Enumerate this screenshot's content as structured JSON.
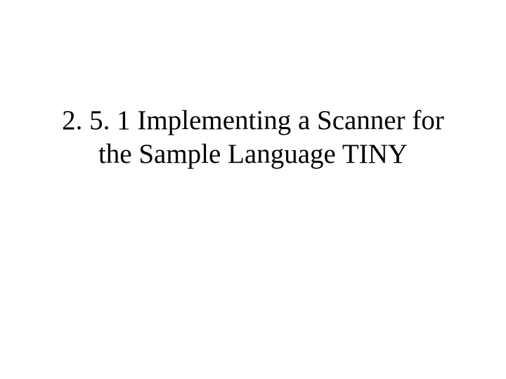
{
  "slide": {
    "heading": "2. 5. 1 Implementing a Scanner for the Sample Language TINY"
  }
}
